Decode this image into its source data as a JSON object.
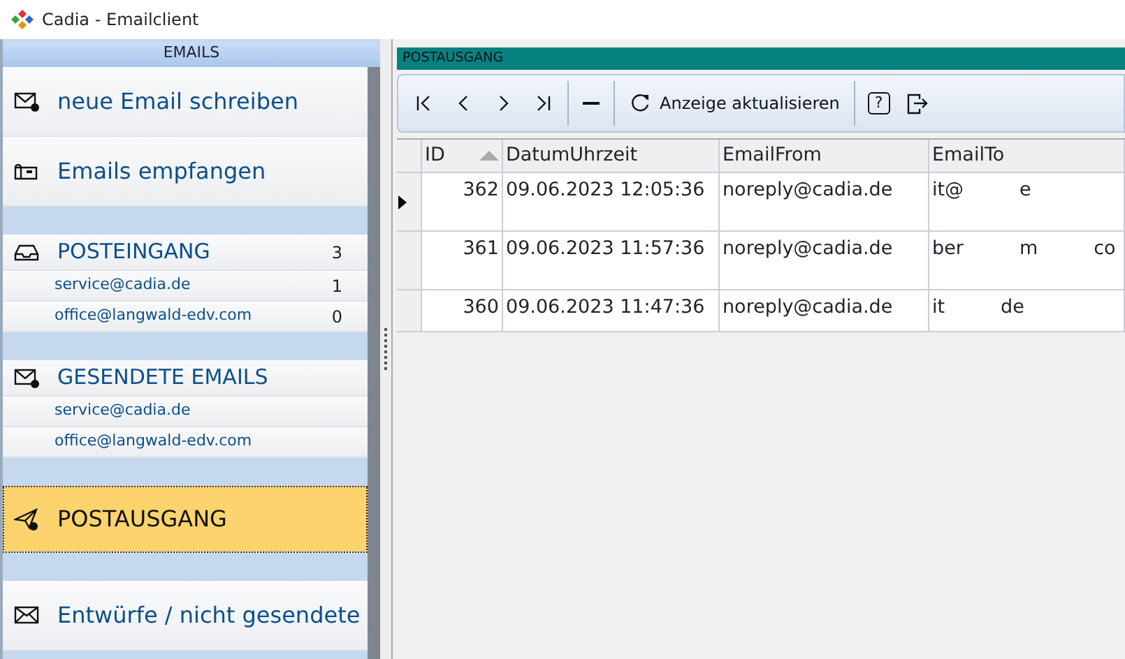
{
  "window": {
    "title": "Cadia - Emailclient"
  },
  "sidebar": {
    "title": "EMAILS",
    "sections": [
      {
        "items": [
          {
            "kind": "action",
            "label": "neue Email schreiben",
            "selected": false
          },
          {
            "kind": "action",
            "label": "Emails empfangen",
            "selected": false
          }
        ]
      },
      {
        "items": [
          {
            "kind": "group",
            "label": "POSTEINGANG",
            "count": "3",
            "selected": false
          },
          {
            "kind": "account",
            "label": "service@cadia.de",
            "count": "1",
            "selected": false
          },
          {
            "kind": "account",
            "label": "office@langwald-edv.com",
            "count": "0",
            "selected": false
          }
        ]
      },
      {
        "items": [
          {
            "kind": "group",
            "label": "GESENDETE EMAILS",
            "selected": false
          },
          {
            "kind": "account",
            "label": "service@cadia.de",
            "selected": false
          },
          {
            "kind": "account",
            "label": "office@langwald-edv.com",
            "selected": false
          }
        ]
      },
      {
        "items": [
          {
            "kind": "action",
            "label": "POSTAUSGANG",
            "selected": true
          }
        ]
      },
      {
        "items": [
          {
            "kind": "action",
            "label": "Entwürfe / nicht gesendete",
            "selected": false
          }
        ]
      }
    ]
  },
  "panel": {
    "title": "POSTAUSGANG",
    "toolbar": [
      {
        "kind": "first"
      },
      {
        "kind": "prev"
      },
      {
        "kind": "next"
      },
      {
        "kind": "last"
      },
      {
        "kind": "sep"
      },
      {
        "kind": "minus"
      },
      {
        "kind": "sep"
      },
      {
        "kind": "refresh",
        "label": "Anzeige aktualisieren"
      },
      {
        "kind": "sep"
      },
      {
        "kind": "help",
        "label": "?"
      },
      {
        "kind": "exit"
      }
    ],
    "table": {
      "columns": [
        {
          "label": "ID",
          "sorted": true
        },
        {
          "label": "DatumUhrzeit",
          "sorted": false
        },
        {
          "label": "EmailFrom",
          "sorted": false
        },
        {
          "label": "EmailTo",
          "sorted": false
        }
      ],
      "rows": [
        {
          "selected": true,
          "cells": [
            [
              "362"
            ],
            [
              "09.06.2023 12:05:36"
            ],
            [
              "noreply@cadia.de"
            ],
            [
              "it@",
              "e"
            ]
          ]
        },
        {
          "selected": false,
          "cells": [
            [
              "361"
            ],
            [
              "09.06.2023 11:57:36"
            ],
            [
              "noreply@cadia.de"
            ],
            [
              "ber",
              "m",
              "co"
            ]
          ]
        },
        {
          "selected": false,
          "cells": [
            [
              "360"
            ],
            [
              "09.06.2023 11:47:36"
            ],
            [
              "noreply@cadia.de"
            ],
            [
              "it",
              "de"
            ]
          ]
        }
      ]
    }
  }
}
